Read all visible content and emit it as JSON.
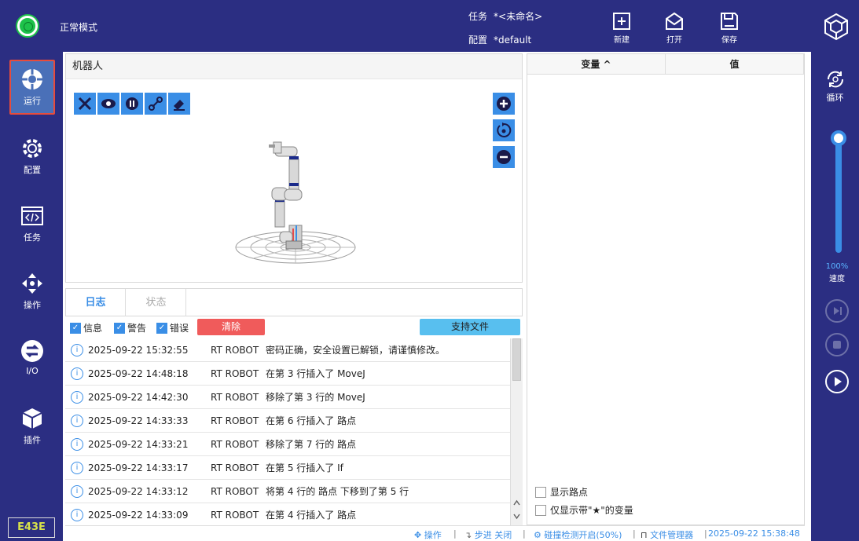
{
  "header": {
    "mode": "正常模式",
    "task_label": "任务",
    "task_value": "*<未命名>",
    "config_label": "配置",
    "config_value": "*default",
    "buttons": [
      {
        "label": "新建",
        "icon": "new-file-icon"
      },
      {
        "label": "打开",
        "icon": "open-envelope-icon"
      },
      {
        "label": "保存",
        "icon": "save-icon"
      }
    ],
    "colors": {
      "bar": "#2b2e82",
      "mode_indicator": "#1ec24a",
      "accent": "#3a8ee6"
    }
  },
  "sidebar": {
    "items": [
      {
        "label": "运行",
        "icon": "run-target-icon",
        "active": true
      },
      {
        "label": "配置",
        "icon": "config-gear-icon"
      },
      {
        "label": "任务",
        "icon": "task-code-icon"
      },
      {
        "label": "操作",
        "icon": "move-arrows-icon"
      },
      {
        "label": "I/O",
        "icon": "io-exchange-icon"
      },
      {
        "label": "插件",
        "icon": "plugin-cube-icon"
      }
    ],
    "badge": "E43E"
  },
  "robot": {
    "title": "机器人",
    "tools": [
      "tools-icon",
      "eye-icon",
      "brake-icon",
      "link-icon",
      "eraser-icon"
    ],
    "zoom": [
      "zoom-in-icon",
      "reset-view-icon",
      "zoom-out-icon"
    ]
  },
  "log": {
    "tabs": [
      {
        "label": "日志",
        "active": true
      },
      {
        "label": "状态",
        "active": false
      }
    ],
    "filters": [
      {
        "label": "信息",
        "checked": true
      },
      {
        "label": "警告",
        "checked": true
      },
      {
        "label": "错误",
        "checked": true
      }
    ],
    "clear_label": "清除",
    "support_label": "支持文件",
    "rows": [
      {
        "time": "2025-09-22 15:32:55",
        "source": "RT ROBOT",
        "message": "密码正确，安全设置已解锁，请谨慎修改。"
      },
      {
        "time": "2025-09-22 14:48:18",
        "source": "RT ROBOT",
        "message": "在第 3 行插入了 MoveJ"
      },
      {
        "time": "2025-09-22 14:42:30",
        "source": "RT ROBOT",
        "message": "移除了第 3 行的 MoveJ"
      },
      {
        "time": "2025-09-22 14:33:33",
        "source": "RT ROBOT",
        "message": "在第 6 行插入了 路点"
      },
      {
        "time": "2025-09-22 14:33:21",
        "source": "RT ROBOT",
        "message": "移除了第 7 行的 路点"
      },
      {
        "time": "2025-09-22 14:33:17",
        "source": "RT ROBOT",
        "message": "在第 5 行插入了 If"
      },
      {
        "time": "2025-09-22 14:33:12",
        "source": "RT ROBOT",
        "message": "将第 4 行的 路点 下移到了第 5 行"
      },
      {
        "time": "2025-09-22 14:33:09",
        "source": "RT ROBOT",
        "message": "在第 4 行插入了 路点"
      }
    ]
  },
  "variables": {
    "col_name": "变量 ^",
    "col_value": "值",
    "show_waypoints": "显示路点",
    "show_starred": "仅显示带\"★\"的变量"
  },
  "right": {
    "cycle_label": "循环",
    "speed_value": "100%",
    "speed_label": "速度",
    "speed_fraction": 1.0
  },
  "status": {
    "operate": "操作",
    "step": "步进 关闭",
    "collision": "碰撞检测开启(50%)",
    "file_manager": "文件管理器",
    "datetime": "2025-09-22 15:38:48"
  }
}
